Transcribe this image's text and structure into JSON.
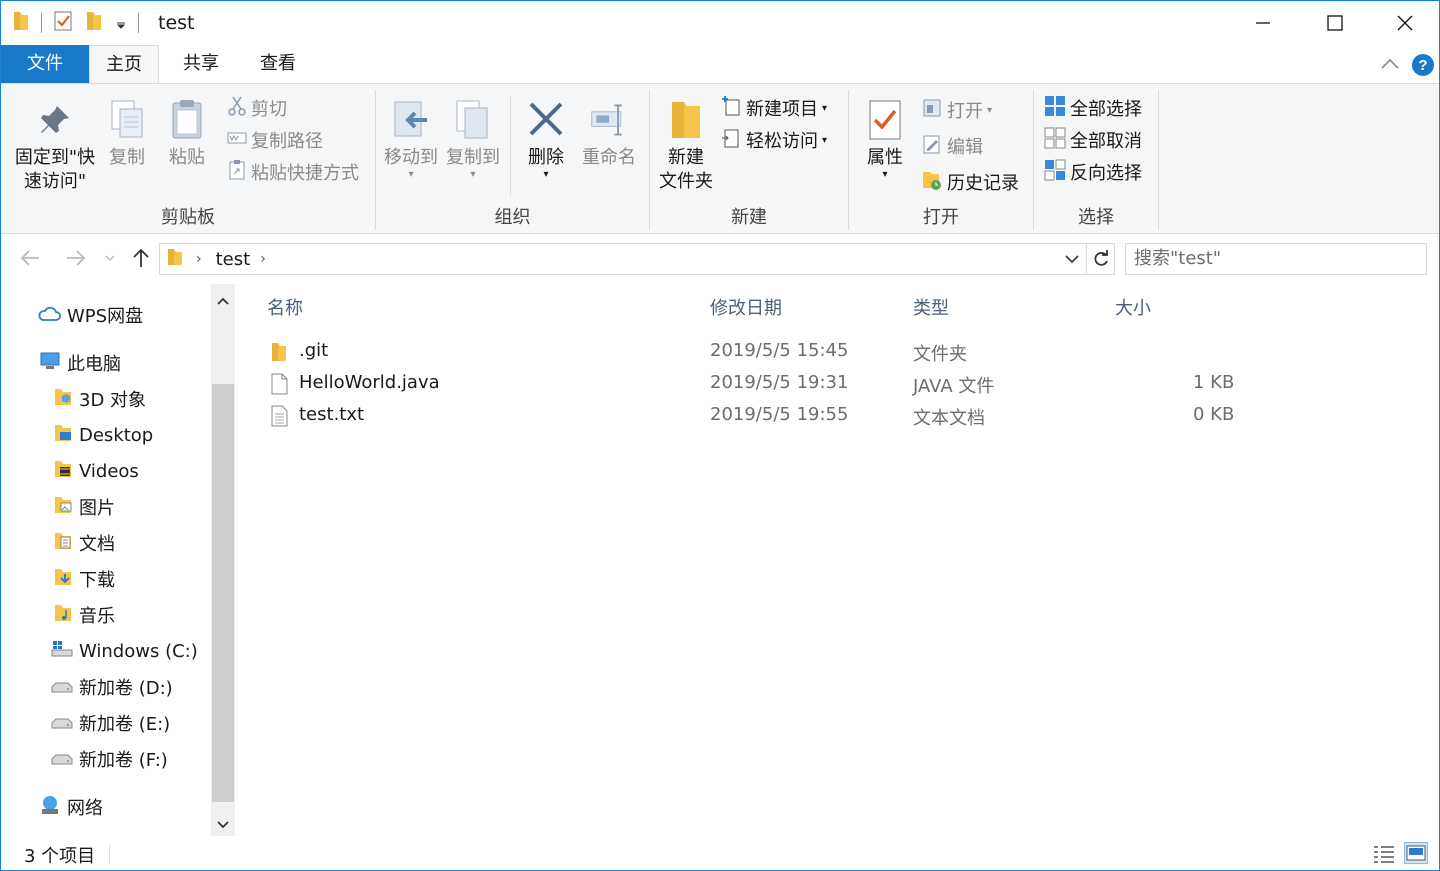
{
  "window": {
    "title": "test",
    "accent": "#1979ca"
  },
  "tabs": {
    "file": "文件",
    "home": "主页",
    "share": "共享",
    "view": "查看"
  },
  "ribbon": {
    "clipboard": {
      "label": "剪贴板",
      "pin": "固定到\"快",
      "pin2": "速访问\"",
      "copy": "复制",
      "paste": "粘贴",
      "cut": "剪切",
      "copy_path": "复制路径",
      "paste_shortcut": "粘贴快捷方式"
    },
    "organize": {
      "label": "组织",
      "move_to": "移动到",
      "copy_to": "复制到",
      "delete": "删除",
      "rename": "重命名"
    },
    "new": {
      "label": "新建",
      "new_folder": "新建",
      "new_folder2": "文件夹",
      "new_item": "新建项目",
      "easy_access": "轻松访问"
    },
    "open": {
      "label": "打开",
      "properties": "属性",
      "open": "打开",
      "edit": "编辑",
      "history": "历史记录"
    },
    "select": {
      "label": "选择",
      "select_all": "全部选择",
      "select_none": "全部取消",
      "invert": "反向选择"
    }
  },
  "address": {
    "crumb": "test",
    "search_placeholder": "搜索\"test\""
  },
  "nav": {
    "items": [
      {
        "label": "WPS网盘"
      },
      {
        "label": "此电脑"
      },
      {
        "label": "3D 对象"
      },
      {
        "label": "Desktop"
      },
      {
        "label": "Videos"
      },
      {
        "label": "图片"
      },
      {
        "label": "文档"
      },
      {
        "label": "下载"
      },
      {
        "label": "音乐"
      },
      {
        "label": "Windows (C:)"
      },
      {
        "label": "新加卷 (D:)"
      },
      {
        "label": "新加卷 (E:)"
      },
      {
        "label": "新加卷 (F:)"
      },
      {
        "label": "网络"
      }
    ]
  },
  "columns": {
    "name": "名称",
    "modified": "修改日期",
    "type": "类型",
    "size": "大小"
  },
  "files": [
    {
      "name": ".git",
      "modified": "2019/5/5 15:45",
      "type": "文件夹",
      "size": ""
    },
    {
      "name": "HelloWorld.java",
      "modified": "2019/5/5 19:31",
      "type": "JAVA 文件",
      "size": "1 KB"
    },
    {
      "name": "test.txt",
      "modified": "2019/5/5 19:55",
      "type": "文本文档",
      "size": "0 KB"
    }
  ],
  "status": {
    "count": "3 个项目"
  }
}
